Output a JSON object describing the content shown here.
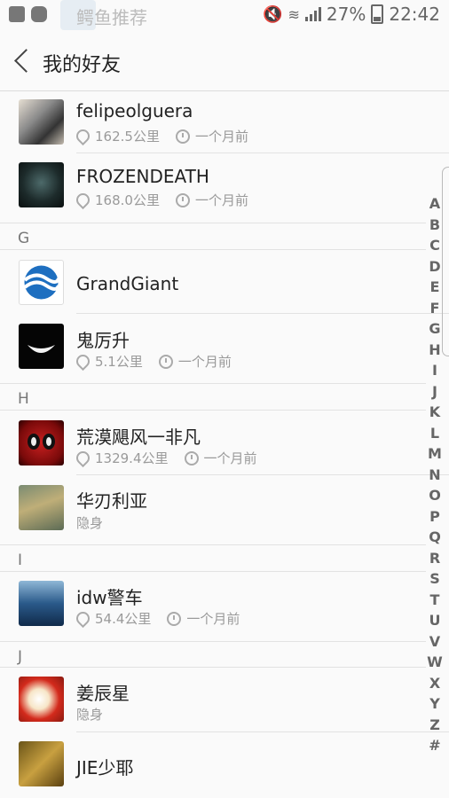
{
  "status_bar": {
    "ghost_notification": "鳄鱼推荐",
    "battery_percent": "27%",
    "time": "22:42"
  },
  "header": {
    "title": "我的好友"
  },
  "friends": [
    {
      "name": "felipeolguera",
      "distance": "162.5公里",
      "time": "一个月前"
    },
    {
      "name": "FROZENDEATH",
      "distance": "168.0公里",
      "time": "一个月前"
    },
    {
      "section": "G"
    },
    {
      "name": "GrandGiant"
    },
    {
      "name": "鬼厉升",
      "distance": "5.1公里",
      "time": "一个月前"
    },
    {
      "section": "H"
    },
    {
      "name": "荒漠飓风一非凡",
      "distance": "1329.4公里",
      "time": "一个月前"
    },
    {
      "name": "华刃利亚",
      "status": "隐身"
    },
    {
      "section": "I"
    },
    {
      "name": "idw警车",
      "distance": "54.4公里",
      "time": "一个月前"
    },
    {
      "section": "J"
    },
    {
      "name": "姜辰星",
      "status": "隐身"
    },
    {
      "name": "JIE少耶"
    }
  ],
  "index_letters": [
    "A",
    "B",
    "C",
    "D",
    "E",
    "F",
    "G",
    "H",
    "I",
    "J",
    "K",
    "L",
    "M",
    "N",
    "O",
    "P",
    "Q",
    "R",
    "S",
    "T",
    "U",
    "V",
    "W",
    "X",
    "Y",
    "Z",
    "#"
  ],
  "colors": {
    "background": "#fafafa",
    "text_primary": "#222222",
    "text_secondary": "#9a9a9a",
    "divider": "#e2e2e2"
  }
}
